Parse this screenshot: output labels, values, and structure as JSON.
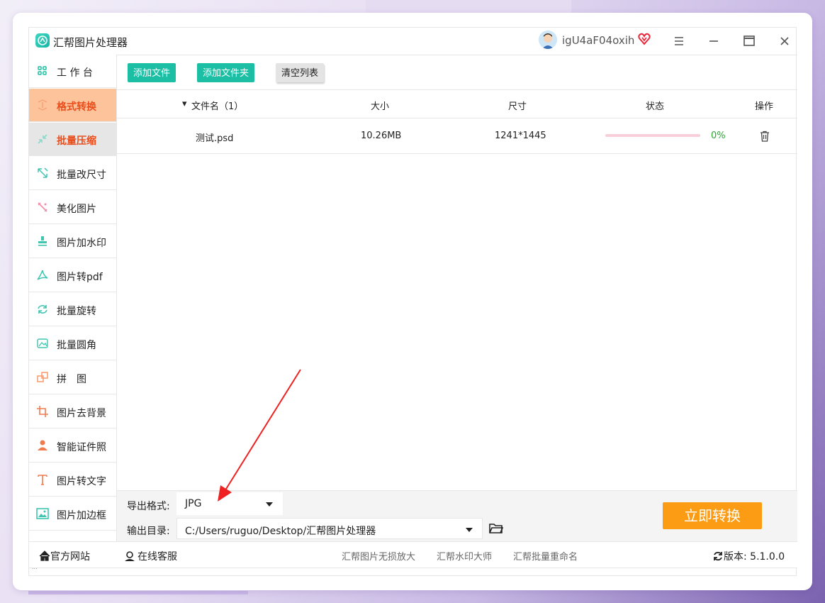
{
  "window": {
    "title": "汇帮图片处理器",
    "username": "igU4aF04oxih",
    "menu_icon": "hamburger-icon",
    "minimize_icon": "minimize-icon",
    "maximize_icon": "maximize-icon",
    "close_icon": "close-icon"
  },
  "sidebar": {
    "items": [
      {
        "label": "工 作 台",
        "icon": "grid-icon",
        "state": "normal"
      },
      {
        "label": "格式转换",
        "icon": "convert-icon",
        "state": "active"
      },
      {
        "label": "批量压缩",
        "icon": "compress-icon",
        "state": "hover"
      },
      {
        "label": "批量改尺寸",
        "icon": "resize-icon",
        "state": "normal"
      },
      {
        "label": "美化图片",
        "icon": "beautify-icon",
        "state": "normal"
      },
      {
        "label": "图片加水印",
        "icon": "watermark-icon",
        "state": "normal"
      },
      {
        "label": "图片转pdf",
        "icon": "pdf-icon",
        "state": "normal"
      },
      {
        "label": "批量旋转",
        "icon": "rotate-icon",
        "state": "normal"
      },
      {
        "label": "批量圆角",
        "icon": "rounded-image-icon",
        "state": "normal"
      },
      {
        "label": "拼　图",
        "icon": "collage-icon",
        "state": "normal"
      },
      {
        "label": "图片去背景",
        "icon": "crop-icon",
        "state": "normal"
      },
      {
        "label": "智能证件照",
        "icon": "person-icon",
        "state": "normal"
      },
      {
        "label": "图片转文字",
        "icon": "text-icon",
        "state": "normal"
      },
      {
        "label": "图片加边框",
        "icon": "frame-icon",
        "state": "normal"
      }
    ]
  },
  "toolbar": {
    "add_file": "添加文件",
    "add_folder": "添加文件夹",
    "clear_list": "清空列表"
  },
  "table": {
    "columns": {
      "name": "文件名（1）",
      "size": "大小",
      "dimensions": "尺寸",
      "status": "状态",
      "actions": "操作"
    },
    "rows": [
      {
        "name": "测试.psd",
        "size": "10.26MB",
        "dimensions": "1241*1445",
        "progress": 0,
        "progress_text": "0%"
      }
    ]
  },
  "settings": {
    "format_label": "导出格式:",
    "format_value": "JPG",
    "output_label": "输出目录:",
    "output_value": "C:/Users/ruguo/Desktop/汇帮图片处理器",
    "convert_button": "立即转换"
  },
  "footer": {
    "official_site": "官方网站",
    "online_service": "在线客服",
    "links": [
      "汇帮图片无损放大",
      "汇帮水印大师",
      "汇帮批量重命名"
    ],
    "version_label": "版本:",
    "version_value": "5.1.0.0"
  },
  "statusbar": {
    "text": "..."
  },
  "colors": {
    "accent_green": "#1cbfa3",
    "active_nav_bg": "#fdc49c",
    "active_nav_text": "#ea4d1c",
    "convert_orange": "#fb9c14",
    "annotation_arrow": "#ee2222"
  }
}
